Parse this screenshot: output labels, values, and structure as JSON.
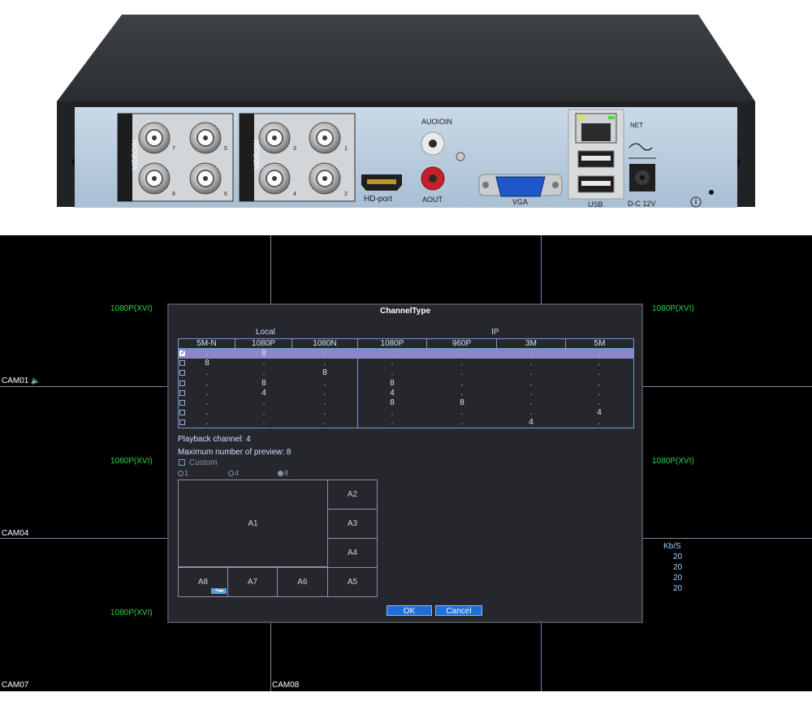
{
  "device": {
    "labels": {
      "videoin_left": "VIDEOIN",
      "videoin_right": "VIDEOIN",
      "bnc_left": [
        "7",
        "5",
        "8",
        "6"
      ],
      "bnc_right": [
        "3",
        "1",
        "4",
        "2"
      ],
      "audio_in": "AUOIOIN",
      "audio_out": "AOUT",
      "hd_port": "HD-port",
      "vga": "VGA",
      "net": "NET",
      "usb": "USB",
      "power": "D-C 12V"
    }
  },
  "screen": {
    "resolution_labels": [
      "1080P(XVI)",
      "1080P(XVI)",
      "1080P(XVI)",
      "1080P(XVI)",
      "1080P(XVI)"
    ],
    "cameras": [
      "CAM01",
      "CAM04",
      "CAM07",
      "CAM08"
    ],
    "bitrate": {
      "header": "Kb/S",
      "values": [
        "20",
        "20",
        "20",
        "20"
      ]
    }
  },
  "dialog": {
    "title": "ChannelType",
    "group_local": "Local",
    "group_ip": "IP",
    "columns": [
      "5M-N",
      "1080P",
      "1080N",
      "1080P",
      "960P",
      "3M",
      "5M"
    ],
    "rows": [
      {
        "checked": true,
        "selected": true,
        "values": [
          ".",
          "8",
          ".",
          ".",
          ".",
          ".",
          "."
        ]
      },
      {
        "checked": false,
        "selected": false,
        "values": [
          "8",
          ".",
          ".",
          ".",
          ".",
          ".",
          "."
        ]
      },
      {
        "checked": false,
        "selected": false,
        "values": [
          ".",
          ".",
          "8",
          ".",
          ".",
          ".",
          "."
        ]
      },
      {
        "checked": false,
        "selected": false,
        "values": [
          ".",
          "8",
          ".",
          "8",
          ".",
          ".",
          "."
        ]
      },
      {
        "checked": false,
        "selected": false,
        "values": [
          ".",
          "4",
          ".",
          "4",
          ".",
          ".",
          "."
        ]
      },
      {
        "checked": false,
        "selected": false,
        "values": [
          ".",
          ".",
          ".",
          "8",
          "8",
          ".",
          "."
        ]
      },
      {
        "checked": false,
        "selected": false,
        "values": [
          ".",
          ".",
          ".",
          ".",
          ".",
          ".",
          "4"
        ]
      },
      {
        "checked": false,
        "selected": false,
        "values": [
          ".",
          ".",
          ".",
          ".",
          ".",
          "4",
          "."
        ]
      }
    ],
    "playback": "Playback channel: 4",
    "max_preview": "Maximum number of preview: 8",
    "custom": "Custom",
    "radios": [
      {
        "label": "1",
        "selected": false
      },
      {
        "label": "4",
        "selected": false
      },
      {
        "label": "8",
        "selected": true
      }
    ],
    "panes": [
      "A1",
      "A2",
      "A3",
      "A4",
      "A5",
      "A6",
      "A7",
      "A8"
    ],
    "swap_icon": "swap-icon",
    "ok": "OK",
    "cancel": "Cancel"
  }
}
